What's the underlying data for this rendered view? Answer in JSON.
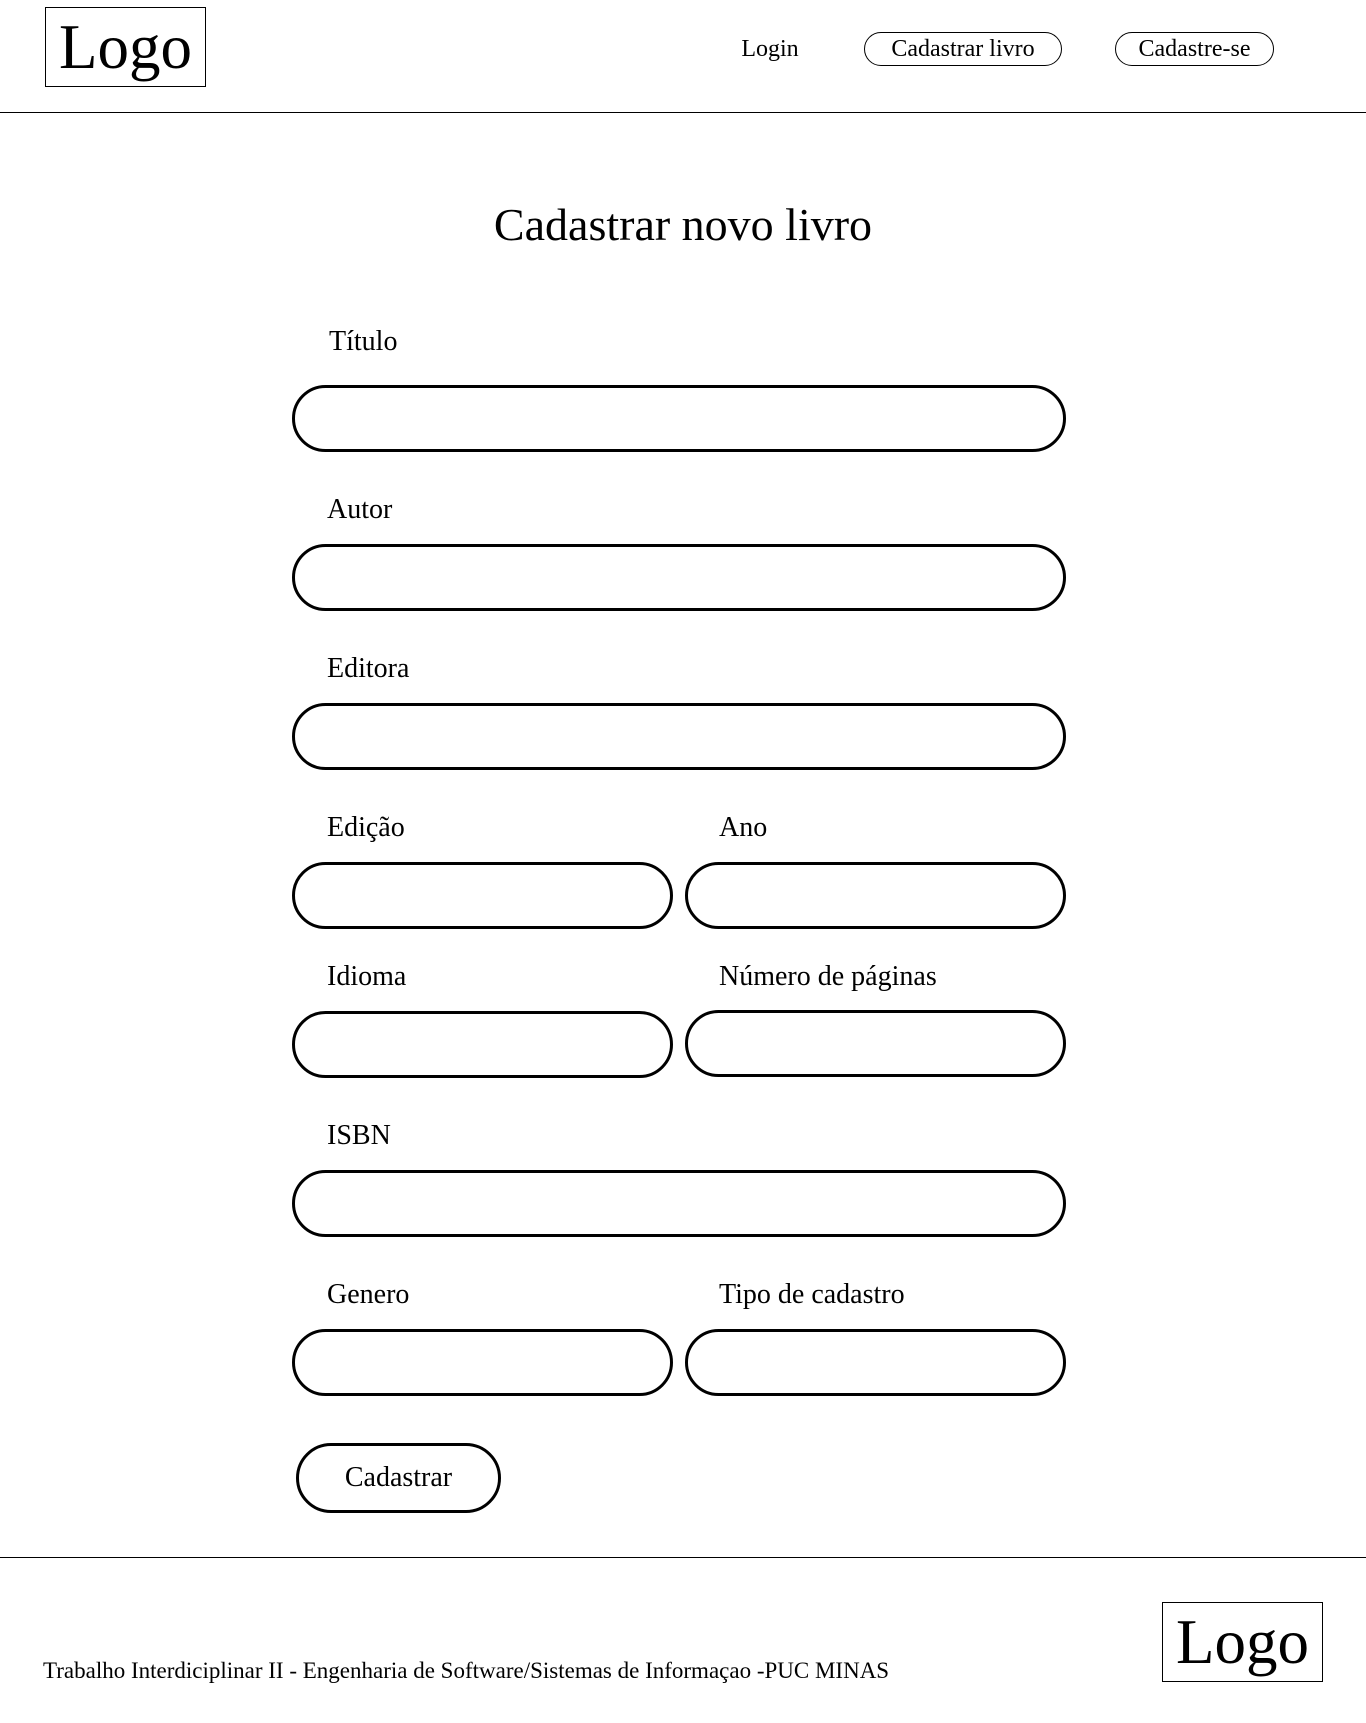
{
  "header": {
    "logo_text": "Logo",
    "nav": {
      "login": "Login",
      "register_book": "Cadastrar livro",
      "sign_up": "Cadastre-se"
    }
  },
  "main": {
    "title": "Cadastrar novo livro",
    "fields": {
      "titulo": {
        "label": "Título",
        "value": ""
      },
      "autor": {
        "label": "Autor",
        "value": ""
      },
      "editora": {
        "label": "Editora",
        "value": ""
      },
      "edicao": {
        "label": "Edição",
        "value": ""
      },
      "ano": {
        "label": "Ano",
        "value": ""
      },
      "idioma": {
        "label": "Idioma",
        "value": ""
      },
      "paginas": {
        "label": "Número de páginas",
        "value": ""
      },
      "isbn": {
        "label": "ISBN",
        "value": ""
      },
      "genero": {
        "label": "Genero",
        "value": ""
      },
      "tipo": {
        "label": "Tipo de cadastro",
        "value": ""
      }
    },
    "submit_label": "Cadastrar"
  },
  "footer": {
    "text": "Trabalho Interdiciplinar II - Engenharia de Software/Sistemas de Informaçao -PUC MINAS",
    "logo_text": "Logo"
  }
}
